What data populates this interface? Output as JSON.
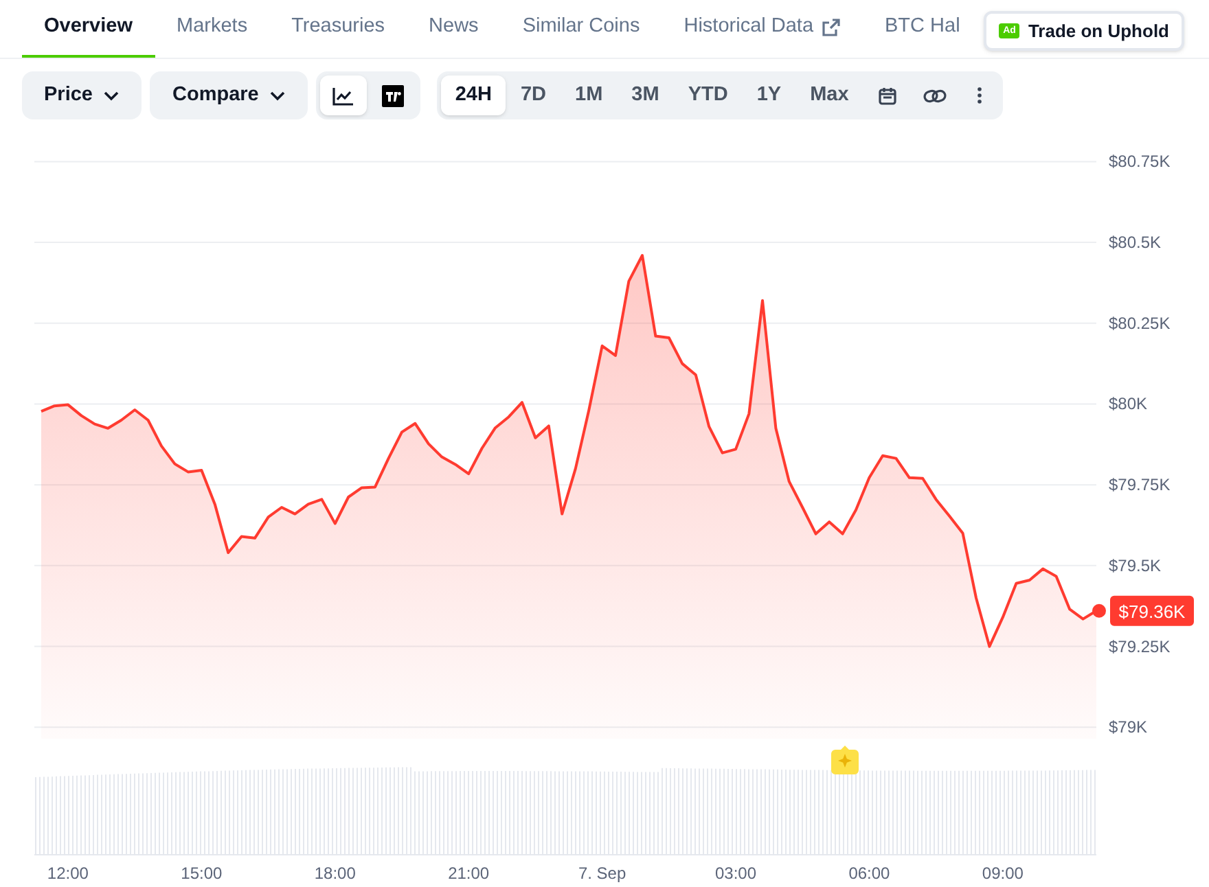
{
  "tabs": [
    {
      "label": "Overview",
      "selected": true,
      "external": false
    },
    {
      "label": "Markets",
      "selected": false,
      "external": false
    },
    {
      "label": "Treasuries",
      "selected": false,
      "external": false
    },
    {
      "label": "News",
      "selected": false,
      "external": false
    },
    {
      "label": "Similar Coins",
      "selected": false,
      "external": false
    },
    {
      "label": "Historical Data",
      "selected": false,
      "external": true
    },
    {
      "label": "BTC Hal",
      "selected": false,
      "external": false
    }
  ],
  "ad_button": {
    "badge": "Ad",
    "label": "Trade on Uphold"
  },
  "toolbar": {
    "dropdowns": [
      "Price",
      "Compare"
    ],
    "view_modes": [
      {
        "kind": "line",
        "selected": true
      },
      {
        "kind": "tradingview",
        "selected": false
      }
    ],
    "ranges": [
      {
        "label": "24H",
        "selected": true
      },
      {
        "label": "7D",
        "selected": false
      },
      {
        "label": "1M",
        "selected": false
      },
      {
        "label": "3M",
        "selected": false
      },
      {
        "label": "YTD",
        "selected": false
      },
      {
        "label": "1Y",
        "selected": false
      },
      {
        "label": "Max",
        "selected": false
      }
    ]
  },
  "chart": {
    "current_price": "$79.36K",
    "chart_data": {
      "type": "area",
      "categories": [
        null,
        null,
        "12:00",
        null,
        null,
        null,
        null,
        null,
        null,
        null,
        null,
        null,
        "15:00",
        null,
        null,
        null,
        null,
        null,
        null,
        null,
        null,
        null,
        "18:00",
        null,
        null,
        null,
        null,
        null,
        null,
        null,
        null,
        null,
        "21:00",
        null,
        null,
        null,
        null,
        null,
        null,
        null,
        null,
        null,
        "7. Sep",
        null,
        null,
        null,
        null,
        null,
        null,
        null,
        null,
        null,
        "03:00",
        null,
        null,
        null,
        null,
        null,
        null,
        null,
        null,
        null,
        "06:00",
        null,
        null,
        null,
        null,
        null,
        null,
        null,
        null,
        null,
        "09:00",
        null,
        null,
        null,
        null,
        null,
        null,
        null
      ],
      "series": [
        {
          "color": "#ff3b30",
          "values": [
            79977,
            79994,
            79998,
            79964,
            79938,
            79925,
            79950,
            79982,
            79950,
            79870,
            79815,
            79790,
            79795,
            79690,
            79540,
            79590,
            79585,
            79650,
            79680,
            79660,
            79690,
            79705,
            79630,
            79712,
            79741,
            79743,
            79832,
            79913,
            79940,
            79877,
            79836,
            79813,
            79784,
            79863,
            79926,
            79960,
            80005,
            79895,
            79932,
            79660,
            79800,
            79980,
            80180,
            80150,
            80380,
            80460,
            80210,
            80205,
            80125,
            80090,
            79930,
            79849,
            79860,
            79970,
            80320,
            79925,
            79760,
            79680,
            79598,
            79635,
            79598,
            79672,
            79772,
            79840,
            79832,
            79772,
            79770,
            79705,
            79653,
            79600,
            79400,
            79250,
            79340,
            79445,
            79455,
            79490,
            79467,
            79365,
            79335,
            79360
          ]
        }
      ],
      "ylim": [
        79000,
        80750
      ],
      "grid": true,
      "yticks": [
        {
          "value": 80750,
          "label": "$80.75K"
        },
        {
          "value": 80500,
          "label": "$80.5K"
        },
        {
          "value": 80250,
          "label": "$80.25K"
        },
        {
          "value": 80000,
          "label": "$80K"
        },
        {
          "value": 79750,
          "label": "$79.75K"
        },
        {
          "value": 79500,
          "label": "$79.5K"
        },
        {
          "value": 79250,
          "label": "$79.25K"
        },
        {
          "value": 79000,
          "label": "$79K"
        }
      ]
    }
  }
}
